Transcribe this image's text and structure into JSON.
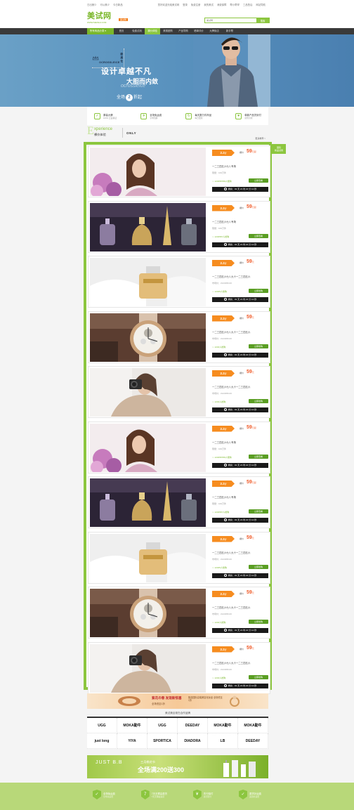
{
  "topbar": {
    "links_left": [
      "日出美少",
      "可以美少",
      "今日新品"
    ],
    "links_right": [
      "您好欢迎光临美试网",
      "登录",
      "免费注册",
      "我的美试",
      "消费保障",
      "帮小帮掌",
      "三品售后",
      "网站导航"
    ]
  },
  "logo": {
    "name": "美试网",
    "url": "WWW.MEISHI.COM",
    "badge": "美试网"
  },
  "search": {
    "placeholder": "美试网",
    "button": "搜索"
  },
  "nav": {
    "category": "所有商品分类 ▾",
    "items": [
      "首页",
      "免费试用",
      "裸价体验",
      "美丽团购",
      "产品导购",
      "晒单评价",
      "大牌街店",
      "新手帮"
    ],
    "active_index": 2
  },
  "banner": {
    "brand_name": "OCROSSLEICE",
    "brand_cn": "欧高仕",
    "slogan1": "设计卓越不凡",
    "slogan2": "大胆而内敛",
    "slogan3": "ocrossleice",
    "slogan4_a": "全场",
    "slogan4_num": "2",
    "slogan4_b": "折起"
  },
  "services": [
    {
      "icon": "✓",
      "title": "原装大牌",
      "sub": "100% 正品保证"
    },
    {
      "icon": "✈",
      "title": "全场免运费",
      "sub": "全场包邮"
    },
    {
      "icon": "↻",
      "title": "每天数万件商品",
      "sub": "每日更新"
    },
    {
      "icon": "♥",
      "title": "单款产品货到付",
      "sub": "货到付款"
    }
  ],
  "experience": {
    "big_e": "E",
    "en": "xperience",
    "cn": "裸价体验",
    "brand": "ONLY",
    "more": "更多推荐 >"
  },
  "side_badge": {
    "line1": "国际",
    "line2": "新品试用"
  },
  "deals": [
    {
      "img": "woman-flowers",
      "discount": "2.2",
      "unit": "折",
      "label": "裸价",
      "price": "59",
      "price_unit": "元起",
      "title": "一二三四五六七八专场",
      "sub_label": "限量：",
      "sub_value": "100万件",
      "count": "123456789",
      "count_unit": "人抢购",
      "buy": "立即查看",
      "timer": "剩余：01 天 21 时 22 分 12 秒"
    },
    {
      "img": "perfume-bottles",
      "discount": "2.2",
      "unit": "折",
      "label": "裸价",
      "price": "59",
      "price_unit": "元起",
      "title": "一二三四五六七八专场",
      "sub_label": "限量：",
      "sub_value": "100万件",
      "count": "1234567",
      "count_unit": "人抢购",
      "buy": "立即查看",
      "timer": "剩余：01 天 21 时 22 分 12 秒"
    },
    {
      "img": "perfume-gift",
      "discount": "2.2",
      "unit": "折",
      "label": "裸价",
      "price": "59",
      "price_unit": "元",
      "title": "一二三四五六七八九十一二三四五六",
      "sub_label": "市场价：",
      "sub_value": "¥123456.00",
      "count": "12345",
      "count_unit": "人抢购",
      "buy": "立即抢购",
      "timer": "剩余：01 天 21 时 22 分 12 秒"
    },
    {
      "img": "watch",
      "discount": "2.2",
      "unit": "折",
      "label": "裸价",
      "price": "59",
      "price_unit": "元",
      "title": "一二三四五六七八九十一二三四五六",
      "sub_label": "市场价：",
      "sub_value": "¥123456.00",
      "count": "1234",
      "count_unit": "人抢购",
      "buy": "立即抢购",
      "timer": "剩余：01 天 21 时 22 分 12 秒"
    },
    {
      "img": "woman-camera",
      "discount": "2.2",
      "unit": "折",
      "label": "裸价",
      "price": "59",
      "price_unit": "元",
      "title": "一二三四五六七八九十一二三四五六",
      "sub_label": "市场价：",
      "sub_value": "¥123456.00",
      "count": "1234",
      "count_unit": "人抢购",
      "buy": "立即抢购",
      "timer": "剩余：01 天 21 时 22 分 12 秒"
    },
    {
      "img": "woman-flowers",
      "discount": "2.2",
      "unit": "折",
      "label": "裸价",
      "price": "59",
      "price_unit": "元起",
      "title": "一二三四五六七八专场",
      "sub_label": "限量：",
      "sub_value": "100万件",
      "count": "123456789",
      "count_unit": "人抢购",
      "buy": "立即查看",
      "timer": "剩余：01 天 21 时 22 分 12 秒"
    },
    {
      "img": "perfume-bottles",
      "discount": "2.2",
      "unit": "折",
      "label": "裸价",
      "price": "59",
      "price_unit": "元起",
      "title": "一二三四五六七八专场",
      "sub_label": "限量：",
      "sub_value": "100万件",
      "count": "1234567",
      "count_unit": "人抢购",
      "buy": "立即查看",
      "timer": "剩余：01 天 21 时 22 分 12 秒"
    },
    {
      "img": "perfume-gift",
      "discount": "2.2",
      "unit": "折",
      "label": "裸价",
      "price": "59",
      "price_unit": "元",
      "title": "一二三四五六七八九十一二三四五六",
      "sub_label": "市场价：",
      "sub_value": "¥123456.00",
      "count": "12345",
      "count_unit": "人抢购",
      "buy": "立即抢购",
      "timer": "剩余：01 天 21 时 22 分 12 秒"
    },
    {
      "img": "watch",
      "discount": "2.2",
      "unit": "折",
      "label": "裸价",
      "price": "59",
      "price_unit": "元",
      "title": "一二三四五六七八九十一二三四五六",
      "sub_label": "市场价：",
      "sub_value": "¥123456.00",
      "count": "1234",
      "count_unit": "人抢购",
      "buy": "立即抢购",
      "timer": "剩余：01 天 21 时 22 分 12 秒"
    },
    {
      "img": "woman-camera",
      "discount": "2.2",
      "unit": "折",
      "label": "裸价",
      "price": "59",
      "price_unit": "元",
      "title": "一二三四五六七八九十一二三四五六",
      "sub_label": "市场价：",
      "sub_value": "¥123456.00",
      "count": "1234",
      "count_unit": "人抢购",
      "buy": "立即抢购",
      "timer": "剩余：01 天 21 时 22 分 12 秒"
    }
  ],
  "promo": {
    "line1": "紫花の春 发现新惊喜",
    "line2": "全场低至1折",
    "line3": "甄选国际高端美容化妆品 全场低至1折"
  },
  "brands_title": "美试美目现在合作品牌",
  "brands": [
    "UGG",
    "MOKA勤牛",
    "UGG",
    "DEEDAY",
    "MOKA勤牛",
    "MOKA勤牛",
    "just long",
    "YIYA",
    "SPORTICA",
    "DIADORA",
    "LB",
    "DEEDAY"
  ],
  "ad2": {
    "brand": "JUST B.B",
    "line1": "三月桃花节",
    "line2": "全场满200送300"
  },
  "footer": [
    {
      "icon": "✓",
      "title": "全场免运费",
      "sub": "全场免运费"
    },
    {
      "icon": "7",
      "title": "7天无理由退货",
      "sub": "7天无理由退货"
    },
    {
      "icon": "¥",
      "title": "先行赔付",
      "sub": "先行赔付"
    },
    {
      "icon": "✓",
      "title": "退货补运费",
      "sub": "退货补运费"
    }
  ],
  "colors": {
    "accent": "#8cc63f",
    "orange": "#f68c1f",
    "price": "#f05a28",
    "nav": "#3a3a3a"
  }
}
